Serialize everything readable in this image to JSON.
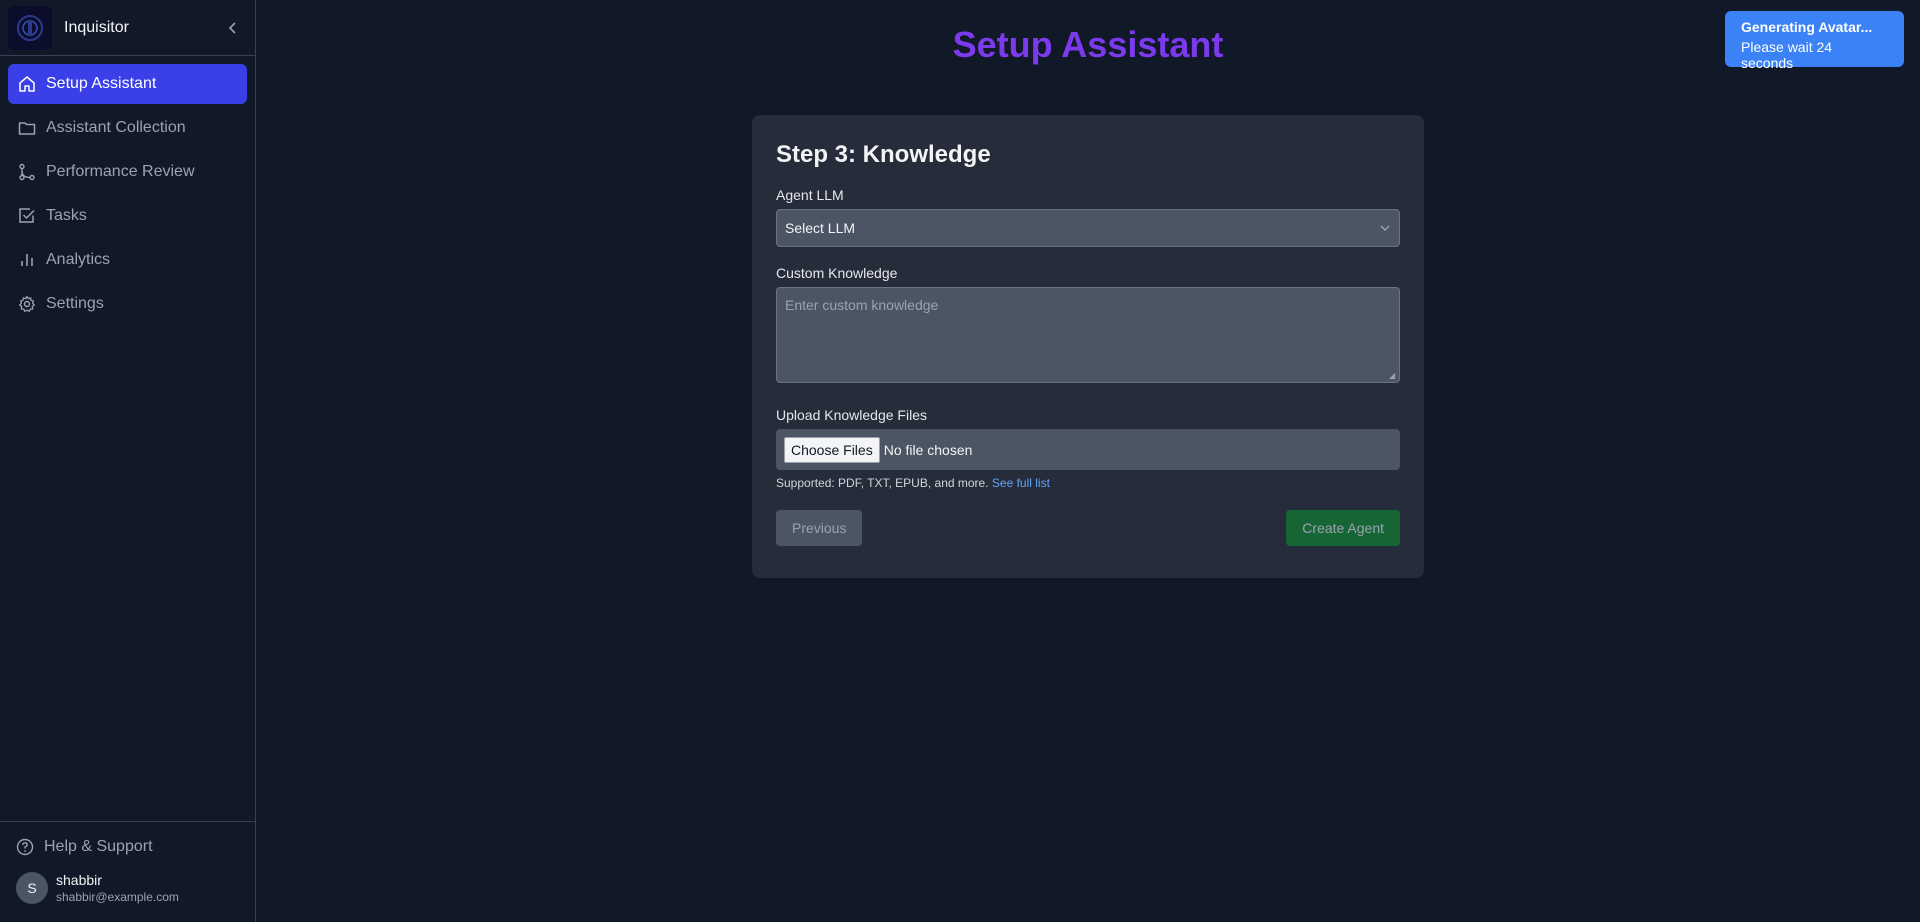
{
  "app": {
    "name": "Inquisitor"
  },
  "sidebar": {
    "items": [
      {
        "label": "Setup Assistant",
        "icon": "home-icon",
        "active": true
      },
      {
        "label": "Assistant Collection",
        "icon": "folder-icon",
        "active": false
      },
      {
        "label": "Performance Review",
        "icon": "git-branch-icon",
        "active": false
      },
      {
        "label": "Tasks",
        "icon": "checkbox-icon",
        "active": false
      },
      {
        "label": "Analytics",
        "icon": "bar-chart-icon",
        "active": false
      },
      {
        "label": "Settings",
        "icon": "gear-icon",
        "active": false
      }
    ],
    "help_label": "Help & Support",
    "user": {
      "initial": "S",
      "name": "shabbir",
      "email": "shabbir@example.com"
    }
  },
  "main": {
    "title": "Setup Assistant",
    "card": {
      "title": "Step 3: Knowledge",
      "llm_label": "Agent LLM",
      "llm_value": "Select LLM",
      "knowledge_label": "Custom Knowledge",
      "knowledge_placeholder": "Enter custom knowledge",
      "upload_label": "Upload Knowledge Files",
      "choose_files": "Choose Files",
      "no_file": "No file chosen",
      "supported_text": "Supported: PDF, TXT, EPUB, and more.",
      "see_full_list": "See full list",
      "previous": "Previous",
      "create": "Create Agent"
    }
  },
  "toast": {
    "title": "Generating Avatar...",
    "message": "Please wait 24 seconds"
  },
  "colors": {
    "accent": "#3b3fe8",
    "title": "#7c3aed",
    "toast": "#3b82f6",
    "create_button": "#166534"
  }
}
